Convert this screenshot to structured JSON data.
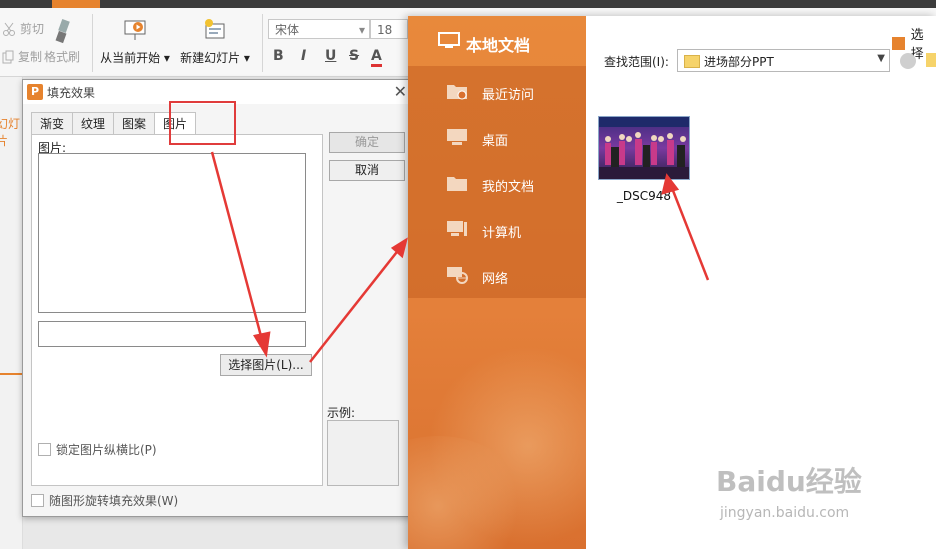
{
  "ribbon": {
    "cut_label": "剪切",
    "copy_label": "复制",
    "format_painter_label": "格式刷",
    "from_current_label": "从当前开始",
    "new_slide_label": "新建幻灯片",
    "font_name": "宋体",
    "font_size": "18",
    "bold": "B",
    "italic": "I",
    "underline": "U",
    "strike": "S",
    "font_color": "A",
    "accent_color": "#e6832e"
  },
  "left_panel": {
    "label": "幻灯片"
  },
  "fill_dialog": {
    "title": "填充效果",
    "tabs": [
      "渐变",
      "纹理",
      "图案",
      "图片"
    ],
    "active_tab": "图片",
    "picture_label": "图片:",
    "select_picture_button": "选择图片(L)...",
    "lock_aspect_label": "锁定图片纵横比(P)",
    "rotate_with_shape_label": "随图形旋转填充效果(W)",
    "ok_button": "确定",
    "cancel_button": "取消",
    "example_label": "示例:"
  },
  "file_browser": {
    "header_title": "本地文档",
    "menu": [
      {
        "label": "最近访问",
        "icon": "recent-folder-icon"
      },
      {
        "label": "桌面",
        "icon": "desktop-icon"
      },
      {
        "label": "我的文档",
        "icon": "folder-icon"
      },
      {
        "label": "计算机",
        "icon": "computer-icon"
      },
      {
        "label": "网络",
        "icon": "network-icon"
      }
    ],
    "top_right_label": "选择",
    "lookin_label": "查找范围(I):",
    "lookin_value": "进场部分PPT",
    "file": {
      "name": "_DSC948"
    }
  },
  "watermark": {
    "brand": "Baidu经验",
    "url": "jingyan.baidu.com"
  }
}
